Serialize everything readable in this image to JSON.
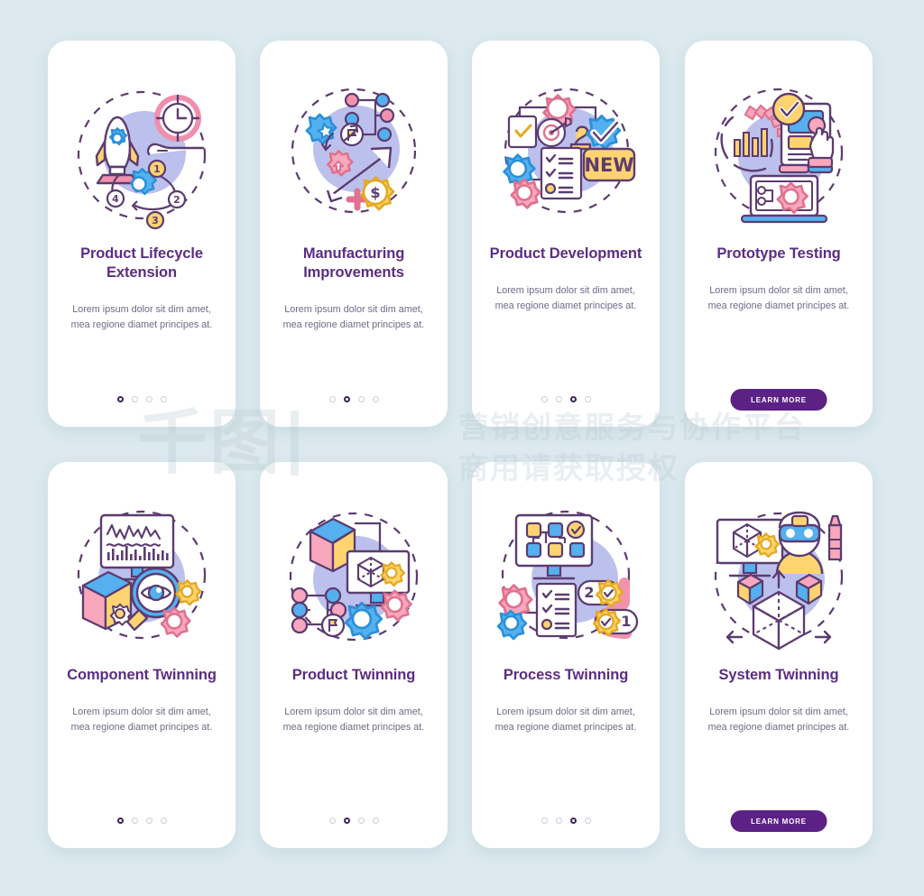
{
  "background_color": "#dceaef",
  "card_background": "#ffffff",
  "title_color": "#5b2d82",
  "body_color": "#6f6a85",
  "button_color": "#5b2185",
  "active_dot_color": "#3c2457",
  "inactive_dot_color": "#cfcbd8",
  "watermark": {
    "logo_glyph": "千图",
    "line1": "营销创意服务与协作平台",
    "line2": "商用请获取授权"
  },
  "cards": [
    {
      "id": "product-lifecycle-extension",
      "title": "Product Lifecycle Extension",
      "description": "Lorem ipsum dolor sit dim amet, mea regione diamet principes at.",
      "illustration": "rocket-clock-hand-gears-cycle",
      "dots": {
        "count": 4,
        "active_index": 0
      },
      "button": null,
      "illustration_labels": [
        "1",
        "2",
        "3",
        "4"
      ]
    },
    {
      "id": "manufacturing-improvements",
      "title": "Manufacturing Improvements",
      "description": "Lorem ipsum dolor sit dim amet, mea regione diamet principes at.",
      "illustration": "gears-flowchart-growth-arrow-dollar",
      "dots": {
        "count": 4,
        "active_index": 1
      },
      "button": null,
      "illustration_labels": [
        "$"
      ]
    },
    {
      "id": "product-development",
      "title": "Product Development",
      "description": "Lorem ipsum dolor sit dim amet, mea regione diamet principes at.",
      "illustration": "gears-checklist-target-new-badge",
      "dots": {
        "count": 4,
        "active_index": 2
      },
      "button": null,
      "illustration_labels": [
        "NEW",
        "2"
      ]
    },
    {
      "id": "prototype-testing",
      "title": "Prototype Testing",
      "description": "Lorem ipsum dolor sit dim amet, mea regione diamet principes at.",
      "illustration": "charts-checkmark-tablet-hand-laptop-gear",
      "dots": null,
      "button": {
        "label": "LEARN MORE"
      },
      "illustration_labels": []
    },
    {
      "id": "component-twinning",
      "title": "Component Twinning",
      "description": "Lorem ipsum dolor sit dim amet, mea regione diamet principes at.",
      "illustration": "monitor-waveform-cube-magnifier-eye-gears",
      "dots": {
        "count": 4,
        "active_index": 0
      },
      "button": null,
      "illustration_labels": []
    },
    {
      "id": "product-twinning",
      "title": "Product Twinning",
      "description": "Lorem ipsum dolor sit dim amet, mea regione diamet principes at.",
      "illustration": "cube-monitor-wireframe-network-gears",
      "dots": {
        "count": 4,
        "active_index": 1
      },
      "button": null,
      "illustration_labels": []
    },
    {
      "id": "process-twinning",
      "title": "Process Twinning",
      "description": "Lorem ipsum dolor sit dim amet, mea regione diamet principes at.",
      "illustration": "flowchart-monitor-checklist-gears-steps",
      "dots": {
        "count": 4,
        "active_index": 2
      },
      "button": null,
      "illustration_labels": [
        "1",
        "2"
      ]
    },
    {
      "id": "system-twinning",
      "title": "System Twinning",
      "description": "Lorem ipsum dolor sit dim amet, mea regione diamet principes at.",
      "illustration": "monitor-cube-vr-person-cubes-arrows",
      "dots": null,
      "button": {
        "label": "LEARN MORE"
      },
      "illustration_labels": []
    }
  ]
}
